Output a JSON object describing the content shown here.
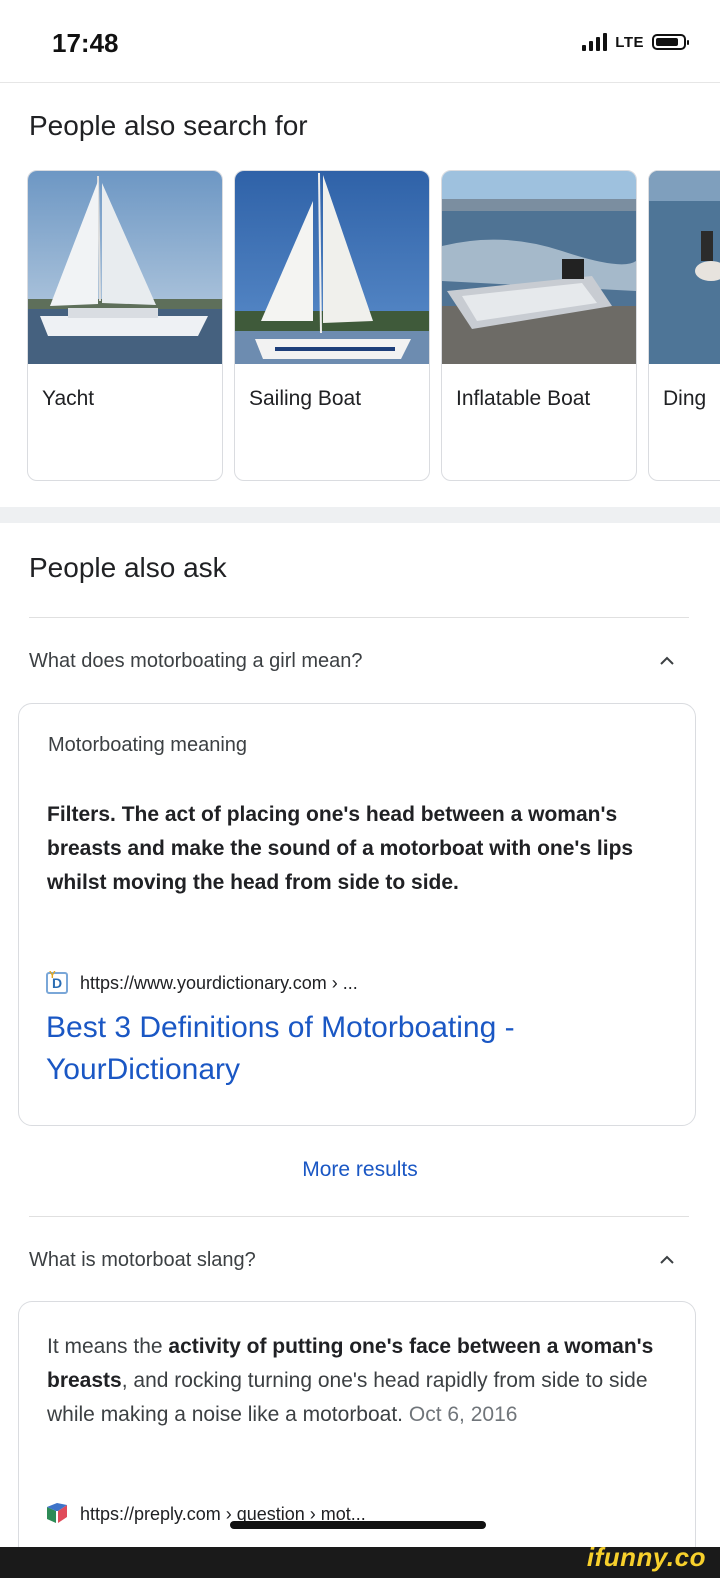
{
  "status_bar": {
    "time": "17:48",
    "network": "LTE"
  },
  "people_also_search": {
    "title": "People also search for",
    "items": [
      {
        "label": "Yacht"
      },
      {
        "label": "Sailing Boat"
      },
      {
        "label": "Inflatable Boat"
      },
      {
        "label": "Ding"
      }
    ]
  },
  "people_also_ask": {
    "title": "People also ask",
    "questions": [
      {
        "question": "What does motorboating a girl mean?",
        "answer_heading": "Motorboating meaning",
        "answer_text": "Filters. The act of placing one's head between a woman's breasts and make the sound of a motorboat with one's lips whilst moving the head from side to side.",
        "source_url": "https://www.yourdictionary.com › ...",
        "result_title": "Best 3 Definitions of Motorboating - YourDictionary"
      },
      {
        "question": "What is motorboat slang?",
        "answer_prefix": "It means the ",
        "answer_bold_1": "activity of putting one's face between a woman's breasts",
        "answer_suffix": ", and rocking turning one's head rapidly from side to side while making a noise like a motorboat.",
        "answer_date": "Oct 6, 2016",
        "source_url": "https://preply.com › question › mot..."
      }
    ],
    "more_results": "More results"
  },
  "watermark": "ifunny.co"
}
